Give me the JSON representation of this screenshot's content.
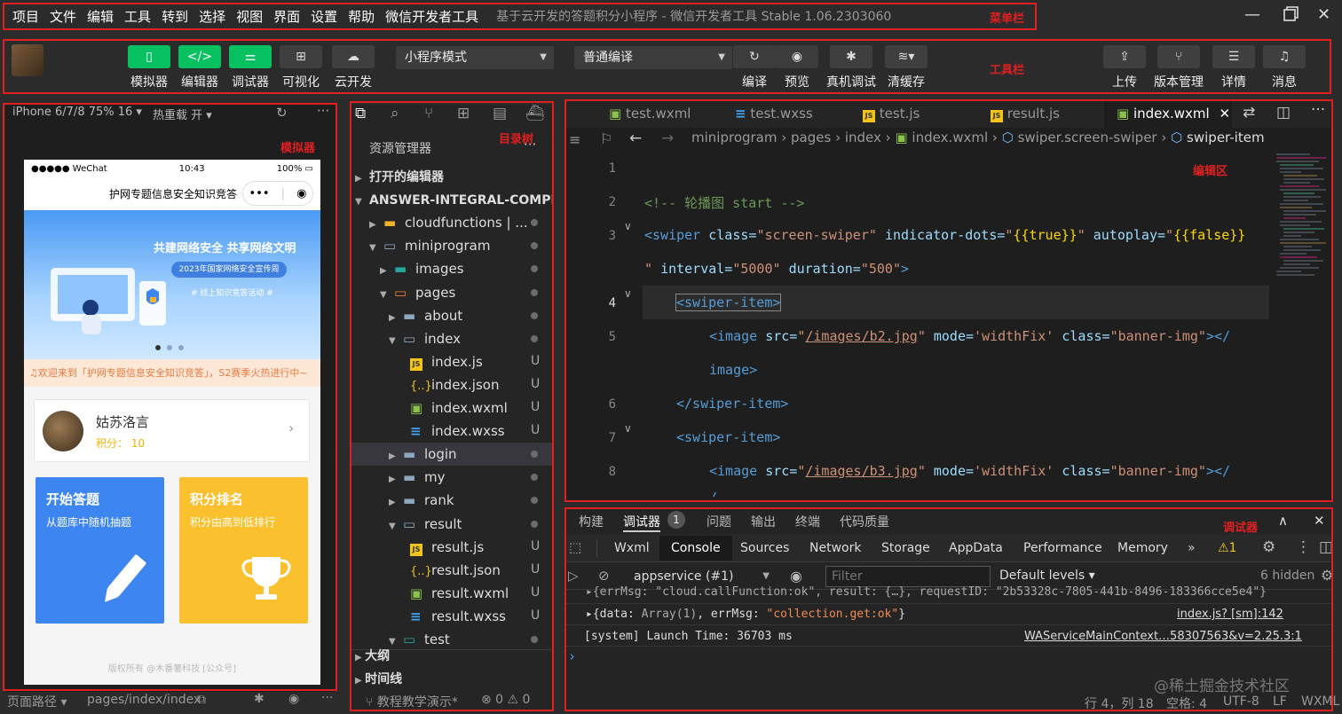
{
  "menubar": {
    "items": [
      "项目",
      "文件",
      "编辑",
      "工具",
      "转到",
      "选择",
      "视图",
      "界面",
      "设置",
      "帮助",
      "微信开发者工具"
    ],
    "title": "基于云开发的答题积分小程序 - 微信开发者工具 Stable 1.06.2303060",
    "annotation": "菜单栏"
  },
  "toolbar": {
    "annotation": "工具栏",
    "left_buttons": [
      "模拟器",
      "编辑器",
      "调试器",
      "可视化",
      "云开发"
    ],
    "mode_select": "小程序模式",
    "compile_select": "普通编译",
    "mid_buttons": [
      "编译",
      "预览",
      "真机调试",
      "清缓存"
    ],
    "right_buttons": [
      "上传",
      "版本管理",
      "详情",
      "消息"
    ]
  },
  "simulator": {
    "annotation": "模拟器",
    "device": "iPhone 6/7/8 75% 16 ▾",
    "hotreload": "热重载 开 ▾",
    "phone": {
      "carrier": "●●●●● WeChat",
      "time": "10:43",
      "battery": "100%",
      "nav_title": "护网专题信息安全知识竞答",
      "banner_headline": "共建网络安全 共享网络文明",
      "banner_sub": "2023年国家网络安全宣传周",
      "banner_note": "# 线上知识竞答活动 #",
      "notice": "♫欢迎来到「护网专题信息安全知识竞答」，S2赛季火热进行中~",
      "user_name": "姑苏洛言",
      "user_points": "积分： 10",
      "card1_title": "开始答题",
      "card1_sub": "从题库中随机抽题",
      "card2_title": "积分排名",
      "card2_sub": "积分由高到低排行",
      "footer": "版权所有 @木番薯科技 [公众号]"
    },
    "bottom_path_label": "页面路径 ▾",
    "bottom_path": "pages/index/index"
  },
  "tree": {
    "annotation": "目录树",
    "header": "资源管理器",
    "items": [
      {
        "label": "打开的编辑器",
        "level": 0,
        "kind": "section",
        "mark": ""
      },
      {
        "label": "ANSWER-INTEGRAL-COMPETITI...",
        "level": 0,
        "kind": "section-open",
        "mark": ""
      },
      {
        "label": "cloudfunctions | ...",
        "level": 1,
        "kind": "folder-cloud",
        "mark": "dot"
      },
      {
        "label": "miniprogram",
        "level": 1,
        "kind": "folder-open",
        "mark": "dot"
      },
      {
        "label": "images",
        "level": 2,
        "kind": "folder-img",
        "mark": "dot"
      },
      {
        "label": "pages",
        "level": 2,
        "kind": "folder-open-orange",
        "mark": "dot"
      },
      {
        "label": "about",
        "level": 3,
        "kind": "folder",
        "mark": "dot"
      },
      {
        "label": "index",
        "level": 3,
        "kind": "folder-open",
        "mark": "dot"
      },
      {
        "label": "index.js",
        "level": 4,
        "kind": "js",
        "mark": "U"
      },
      {
        "label": "index.json",
        "level": 4,
        "kind": "json",
        "mark": "U"
      },
      {
        "label": "index.wxml",
        "level": 4,
        "kind": "wxml",
        "mark": "U"
      },
      {
        "label": "index.wxss",
        "level": 4,
        "kind": "wxss",
        "mark": "U"
      },
      {
        "label": "login",
        "level": 3,
        "kind": "folder",
        "mark": "dot"
      },
      {
        "label": "my",
        "level": 3,
        "kind": "folder",
        "mark": "dot"
      },
      {
        "label": "rank",
        "level": 3,
        "kind": "folder",
        "mark": "dot"
      },
      {
        "label": "result",
        "level": 3,
        "kind": "folder-open",
        "mark": "dot"
      },
      {
        "label": "result.js",
        "level": 4,
        "kind": "js",
        "mark": "U"
      },
      {
        "label": "result.json",
        "level": 4,
        "kind": "json",
        "mark": "U"
      },
      {
        "label": "result.wxml",
        "level": 4,
        "kind": "wxml",
        "mark": "U"
      },
      {
        "label": "result.wxss",
        "level": 4,
        "kind": "wxss",
        "mark": "U"
      },
      {
        "label": "test",
        "level": 3,
        "kind": "folder-open-teal",
        "mark": "dot"
      }
    ],
    "outline": "大纲",
    "timeline": "时间线",
    "branch": "教程教学演示*",
    "problems": "⊗ 0 ⚠ 0"
  },
  "editor": {
    "annotation": "编辑区",
    "tabs": [
      "test.wxml",
      "test.wxss",
      "test.js",
      "result.js",
      "index.wxml"
    ],
    "breadcrumb": [
      "miniprogram",
      "pages",
      "index",
      "index.wxml",
      "swiper.screen-swiper",
      "swiper-item"
    ],
    "line_numbers": [
      "1",
      "2",
      "3",
      "",
      "4",
      "5",
      "",
      "6",
      "7",
      "8"
    ],
    "comment": "<!-- 轮播图 start -->",
    "swiper_tag": "<swiper",
    "attr_class": "class=",
    "val_screen_swiper": "\"screen-swiper\"",
    "attr_dots": "indicator-dots=",
    "attr_autoplay": "autoplay=",
    "q_open": "\"",
    "braces_true": "{{true}}",
    "braces_false": "{{false}}",
    "wrap3": "\" interval=\"5000\" duration=\"500\">",
    "wrap3_a": "\"",
    "wrap3_interval": "interval=",
    "wrap3_v1": "\"5000\"",
    "wrap3_duration": "duration=",
    "wrap3_v2": "\"500\"",
    "swiper_item_open": "<swiper-item>",
    "swiper_item_close": "</swiper-item>",
    "img_tag": "<image",
    "attr_src": "src=",
    "q": "\"",
    "src1": "/images/b2.jpg",
    "src2": "/images/b3.jpg",
    "attr_mode": "mode=",
    "mode_val": "'widthFix'",
    "banner_val": "\"banner-img\"",
    "close_a": "></",
    "close_b": "image>",
    "gt": ">",
    "last_fragment": "/"
  },
  "debugger": {
    "annotation": "调试器",
    "top_tabs": [
      "构建",
      "调试器",
      "问题",
      "输出",
      "终端",
      "代码质量"
    ],
    "badge": "1",
    "panel_tabs": [
      "Wxml",
      "Console",
      "Sources",
      "Network",
      "Storage",
      "AppData",
      "Performance",
      "Memory"
    ],
    "more": "»",
    "warn_count": "⚠1",
    "context": "appservice (#1)",
    "filter_placeholder": "Filter",
    "levels": "Default levels ▾",
    "hidden": "6 hidden",
    "log1": "▸{errMsg: \"cloud.callFunction:ok\", result: {…}, requestID: \"2b53328c-7805-441b-8496-183366cce5e4\"}",
    "log2_prefix": "▸{data: ",
    "log2_array": "Array(1)",
    "log2_mid": ", errMsg: ",
    "log2_str": "\"collection.get:ok\"",
    "log2_end": "}",
    "log2_src": "index.js? [sm]:142",
    "log3": "[system] Launch Time: 36703 ms",
    "log3_src": "WAServiceMainContext…58307563&v=2.25.3:1",
    "prompt": "›"
  },
  "statusbar": {
    "position": "行 4，列 18",
    "spaces": "空格: 4",
    "encoding": "UTF-8",
    "eol": "LF",
    "lang": "WXML"
  },
  "watermark": "@稀土掘金技术社区"
}
